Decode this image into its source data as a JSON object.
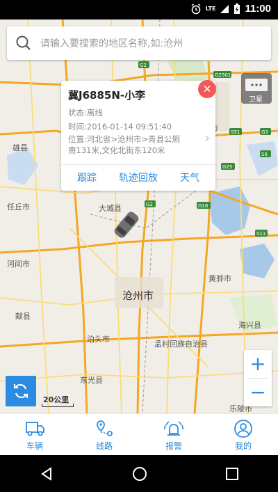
{
  "status_bar": {
    "time": "11:00",
    "network": "LTE"
  },
  "search": {
    "placeholder": "请输入要搜索的地区名称,如:沧州"
  },
  "popup": {
    "title": "冀J6885N-小李",
    "status": "状态:离线",
    "time": "时间:2016-01-14 09:51:40",
    "location_line1": "位置:河北省>沧州市>青县公厕",
    "location_line2": "南131米,文化北街东120米",
    "actions": {
      "track": "跟踪",
      "playback": "轨迹回放",
      "weather": "天气"
    }
  },
  "map": {
    "labels": {
      "city": "沧州市",
      "daicheng": "大城县",
      "renqiu": "任丘市",
      "hejian": "河间市",
      "xianxian": "献县",
      "botou": "泊头市",
      "dongguang": "东光县",
      "mengcun": "孟村回族自治县",
      "huanghua": "黄骅市",
      "haixing": "海兴县",
      "bazhou": "霸州",
      "xiong": "雄县",
      "shi": "市",
      "leling": "乐陵市"
    },
    "road_shields": [
      "G2",
      "G2501",
      "S51",
      "G3",
      "S6",
      "G25",
      "G18",
      "S11"
    ],
    "scale": "20公里",
    "layer_label": "卫星"
  },
  "tabs": [
    {
      "label": "车辆",
      "icon": "truck-icon"
    },
    {
      "label": "线路",
      "icon": "route-icon"
    },
    {
      "label": "报警",
      "icon": "alarm-icon"
    },
    {
      "label": "我的",
      "icon": "profile-icon"
    }
  ],
  "colors": {
    "accent": "#2a8be0",
    "close": "#f25858",
    "highway": "#f5a623"
  }
}
